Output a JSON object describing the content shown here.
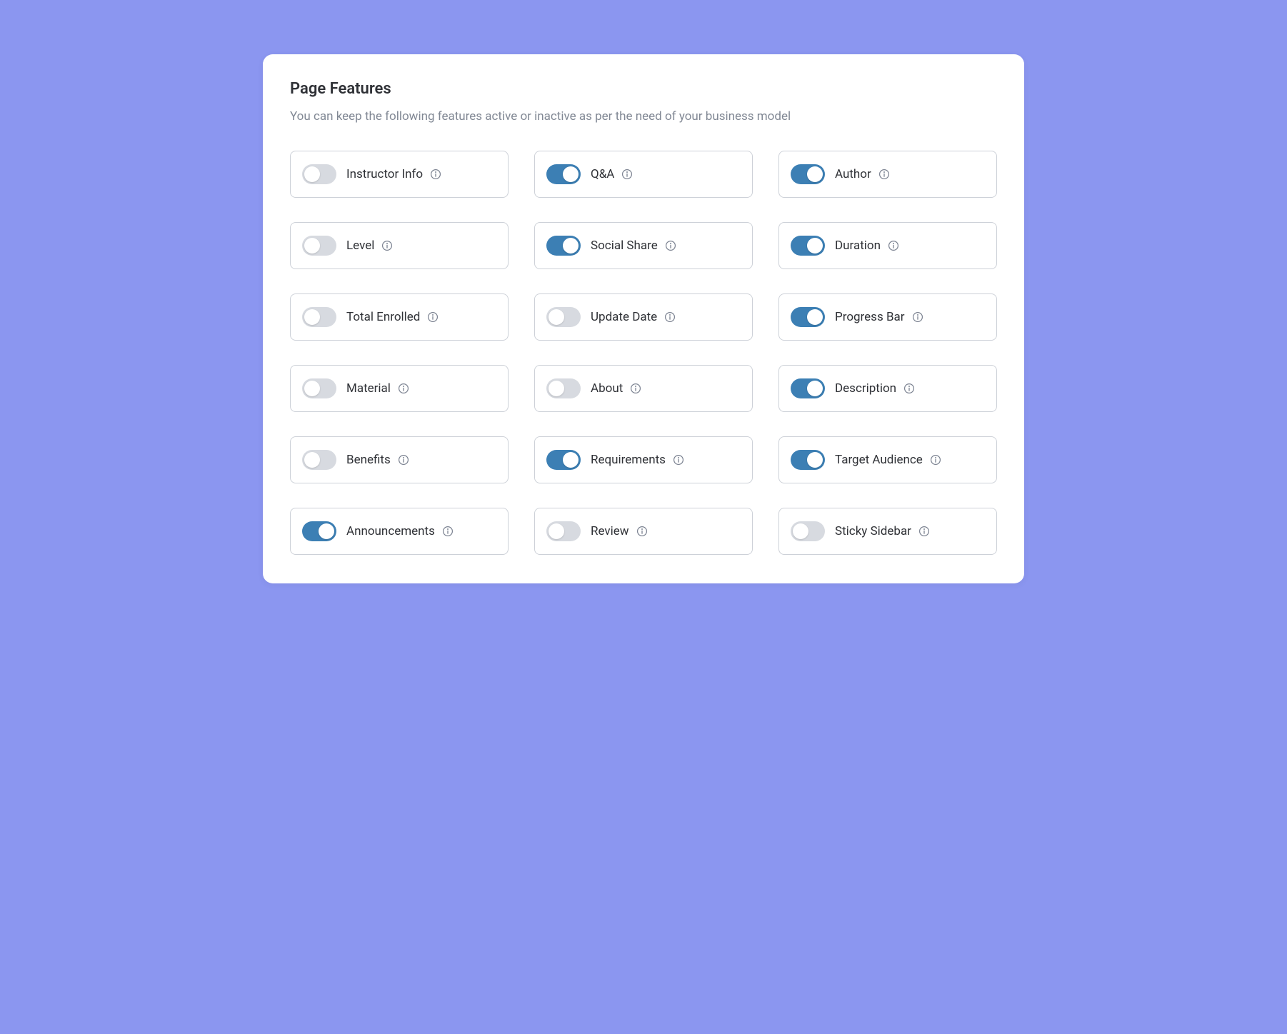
{
  "header": {
    "title": "Page Features",
    "description": "You can keep the following features active or inactive as per the need of your business model"
  },
  "features": [
    {
      "id": "instructor-info",
      "label": "Instructor Info",
      "active": false
    },
    {
      "id": "q-and-a",
      "label": "Q&A",
      "active": true
    },
    {
      "id": "author",
      "label": "Author",
      "active": true
    },
    {
      "id": "level",
      "label": "Level",
      "active": false
    },
    {
      "id": "social-share",
      "label": "Social Share",
      "active": true
    },
    {
      "id": "duration",
      "label": "Duration",
      "active": true
    },
    {
      "id": "total-enrolled",
      "label": "Total Enrolled",
      "active": false
    },
    {
      "id": "update-date",
      "label": "Update Date",
      "active": false
    },
    {
      "id": "progress-bar",
      "label": "Progress Bar",
      "active": true
    },
    {
      "id": "material",
      "label": "Material",
      "active": false
    },
    {
      "id": "about",
      "label": "About",
      "active": false
    },
    {
      "id": "description",
      "label": "Description",
      "active": true
    },
    {
      "id": "benefits",
      "label": "Benefits",
      "active": false
    },
    {
      "id": "requirements",
      "label": "Requirements",
      "active": true
    },
    {
      "id": "target-audience",
      "label": "Target Audience",
      "active": true
    },
    {
      "id": "announcements",
      "label": "Announcements",
      "active": true
    },
    {
      "id": "review",
      "label": "Review",
      "active": false
    },
    {
      "id": "sticky-sidebar",
      "label": "Sticky Sidebar",
      "active": false
    }
  ]
}
